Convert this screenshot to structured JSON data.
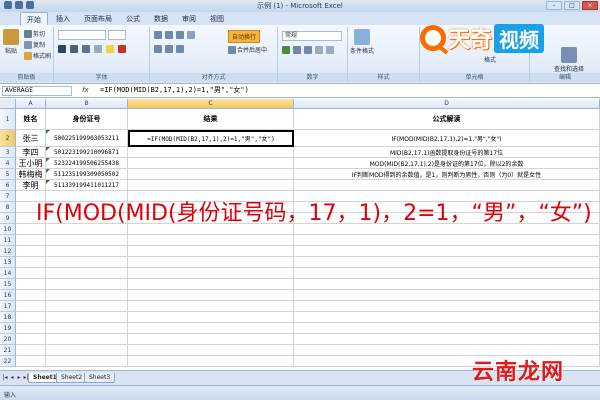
{
  "window": {
    "title": "示例 (1) - Microsoft Excel"
  },
  "tabs": [
    {
      "label": "开始",
      "active": true
    },
    {
      "label": "插入"
    },
    {
      "label": "页面布局"
    },
    {
      "label": "公式"
    },
    {
      "label": "数据"
    },
    {
      "label": "审阅"
    },
    {
      "label": "视图"
    }
  ],
  "ribbon": {
    "clipboard": {
      "label": "剪贴板",
      "paste": "粘贴",
      "cut": "剪切",
      "copy": "复制",
      "format_painter": "格式刷"
    },
    "font": {
      "label": "字体"
    },
    "alignment": {
      "label": "对齐方式",
      "wrap": "自动换行",
      "merge": "合并后居中"
    },
    "number": {
      "label": "数字",
      "format": "常规"
    },
    "styles": {
      "label": "样式",
      "conditional": "条件格式",
      "table": "套用表格格式",
      "cell": "单元格样式"
    },
    "cells": {
      "label": "单元格",
      "insert": "插入",
      "delete": "删除",
      "format": "格式"
    },
    "editing": {
      "label": "编辑",
      "find": "查找和选择"
    }
  },
  "formula_bar": {
    "name_box": "AVERAGE",
    "fx": "fx",
    "formula": "=IF(MOD(MID(B2,17,1),2)=1,\"男\",\"女\")"
  },
  "columns": [
    "A",
    "B",
    "C",
    "D"
  ],
  "rows": [
    "1",
    "2",
    "3",
    "4",
    "5",
    "6",
    "7",
    "8",
    "9",
    "10",
    "11",
    "12",
    "13",
    "14",
    "15",
    "16",
    "17",
    "18",
    "19",
    "20",
    "21",
    "22"
  ],
  "table": {
    "headers": [
      "姓名",
      "身份证号",
      "结果",
      "公式解读"
    ],
    "names": [
      "张三",
      "李四",
      "王小明",
      "韩梅梅",
      "李明"
    ],
    "ids": [
      "500225199903053211",
      "501223199210096871",
      "523224199506255438",
      "511235199309050502",
      "511339199411011217"
    ],
    "active_cell": "=IF(MOD(MID(B2,17,1),2)=1,\"男\",\"女\")",
    "explanations": [
      "IF(MOD(MID(B2,17,1),2)=1,\"男\",\"女\")",
      "MID(B2,17,1)函数提取身份证号的第17位",
      "MOD(MID(B2,17,1),2)是身份证的第17位，除以2的余数",
      "IF判断MOD得到的余数值，是1，则判断为男性，否则（为0）就是女性"
    ]
  },
  "overlay": {
    "text": "IF(MOD(MID(身份证号码，17，1)，2=1，“男”，“女”)"
  },
  "sheet_tabs": [
    "Sheet1",
    "Sheet2",
    "Sheet3"
  ],
  "status": {
    "mode": "输入"
  },
  "logo": {
    "brand1": "天奇",
    "brand2": "视频"
  },
  "watermark": "云南龙网"
}
